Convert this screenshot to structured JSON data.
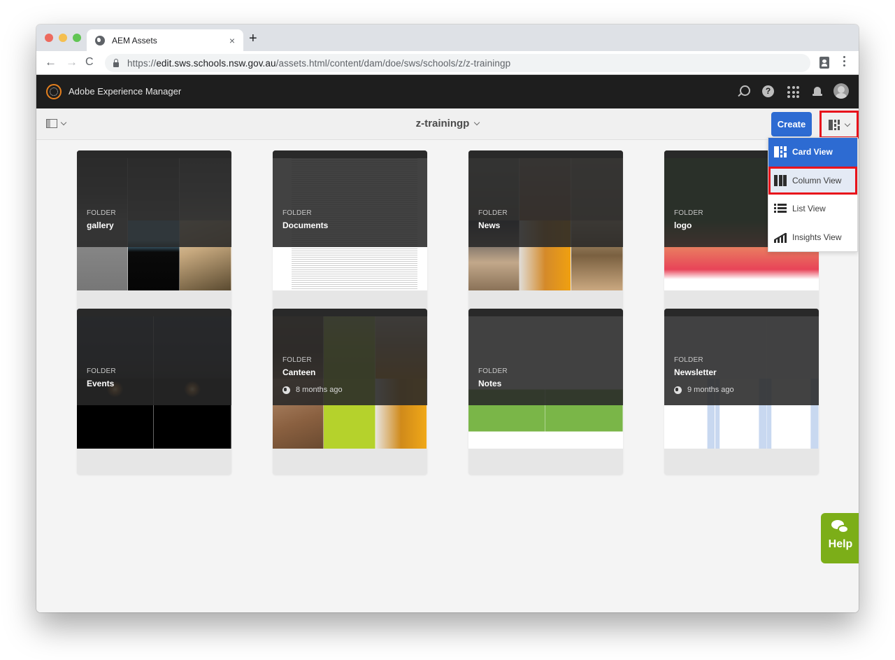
{
  "browser": {
    "tab_title": "AEM Assets",
    "tab_close": "×",
    "new_tab": "+",
    "url_scheme": "https://",
    "url_host": "edit.sws.schools.nsw.gov.au",
    "url_path": "/assets.html/content/dam/doe/sws/schools/z/z-trainingp",
    "nav": {
      "back": "←",
      "forward": "→",
      "reload": "C"
    }
  },
  "app": {
    "title": "Adobe Experience Manager",
    "header_icons": [
      "search-icon",
      "help-icon",
      "apps-icon",
      "notifications-icon",
      "avatar"
    ],
    "help_glyph": "?"
  },
  "actionbar": {
    "folder_title": "z-trainingp",
    "create_label": "Create",
    "current_view_icon": "card-view-icon"
  },
  "view_menu": {
    "items": [
      {
        "label": "Card View",
        "icon": "card-view-icon",
        "state": "active"
      },
      {
        "label": "Column View",
        "icon": "column-view-icon",
        "state": "highlighted"
      },
      {
        "label": "List View",
        "icon": "list-view-icon",
        "state": ""
      },
      {
        "label": "Insights View",
        "icon": "insights-view-icon",
        "state": ""
      }
    ]
  },
  "cards": [
    {
      "type": "FOLDER",
      "name": "gallery",
      "modified": ""
    },
    {
      "type": "FOLDER",
      "name": "Documents",
      "modified": ""
    },
    {
      "type": "FOLDER",
      "name": "News",
      "modified": ""
    },
    {
      "type": "FOLDER",
      "name": "logo",
      "modified": ""
    },
    {
      "type": "FOLDER",
      "name": "Events",
      "modified": ""
    },
    {
      "type": "FOLDER",
      "name": "Canteen",
      "modified": "8 months ago"
    },
    {
      "type": "FOLDER",
      "name": "Notes",
      "modified": ""
    },
    {
      "type": "FOLDER",
      "name": "Newsletter",
      "modified": "9 months ago"
    }
  ],
  "help": {
    "label": "Help"
  },
  "colors": {
    "header_bg": "#1e1e1e",
    "primary_blue": "#2d6bd2",
    "highlight_red": "#e8121b",
    "help_green": "#7cae18",
    "aem_logo_orange": "#e5801e"
  }
}
